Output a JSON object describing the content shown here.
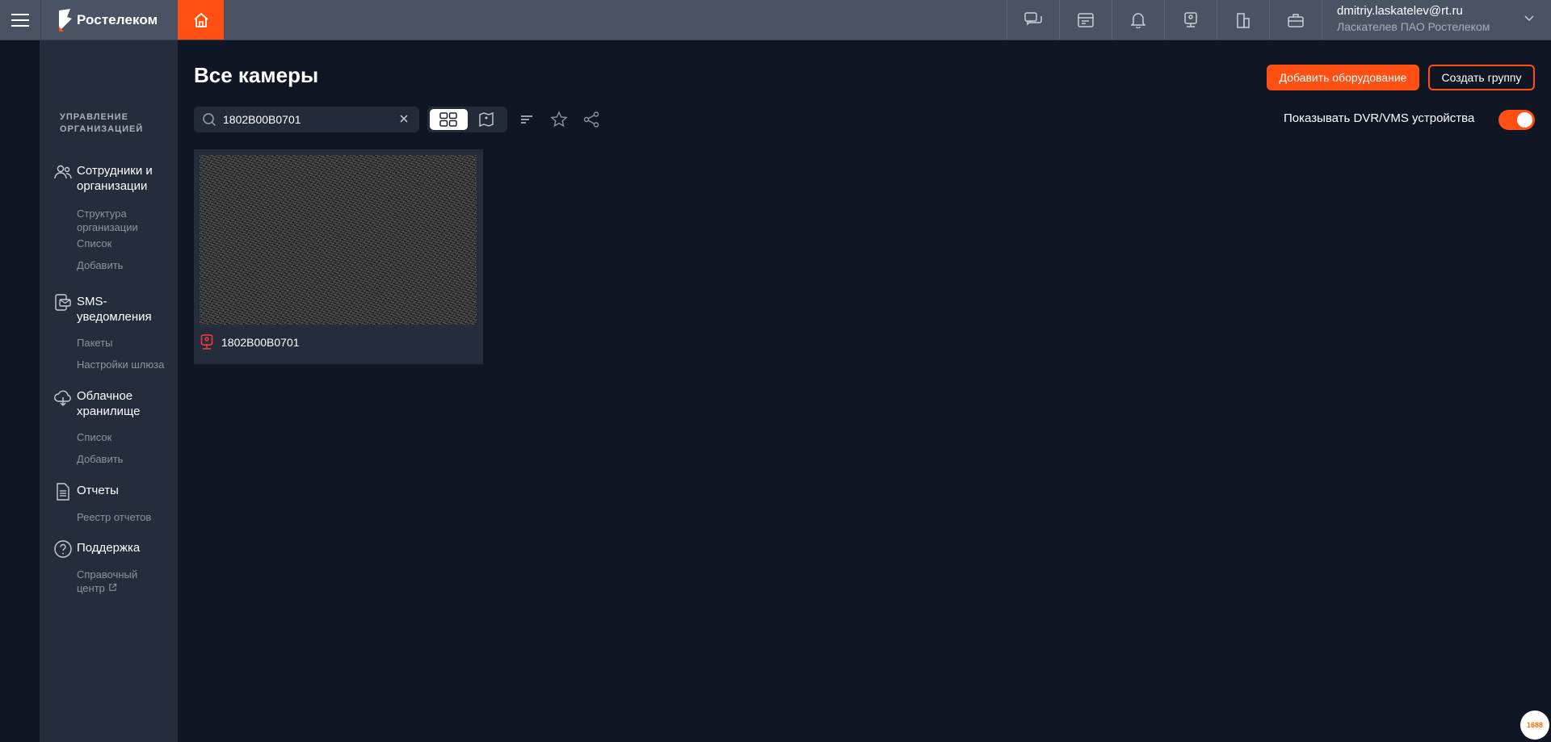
{
  "brand": {
    "name": "Ростелеком",
    "accent": "#ff4f12"
  },
  "user": {
    "email": "dmitriy.laskatelev@rt.ru",
    "org": "Ласкателев ПАО Ростелеком"
  },
  "topbar_icons": [
    "chat-icon",
    "billing-icon",
    "bell-icon",
    "camera-icon",
    "building-icon",
    "briefcase-icon"
  ],
  "sidebar": {
    "heading": "Управление организацией",
    "sections": [
      {
        "icon": "users-icon",
        "label": "Сотрудники и организации",
        "items": [
          "Структура организации",
          "Список",
          "Добавить"
        ]
      },
      {
        "icon": "sms-icon",
        "label": "SMS-уведомления",
        "items": [
          "Пакеты",
          "Настройки шлюза"
        ]
      },
      {
        "icon": "cloud-icon",
        "label": "Облачное хранилище",
        "items": [
          "Список",
          "Добавить"
        ]
      },
      {
        "icon": "document-icon",
        "label": "Отчеты",
        "items": [
          "Реестр отчетов"
        ]
      },
      {
        "icon": "help-icon",
        "label": "Поддержка",
        "items": [
          "Справочный центр"
        ]
      }
    ]
  },
  "main": {
    "title": "Все камеры",
    "add_equipment_label": "Добавить оборудование",
    "create_group_label": "Создать группу",
    "search_value": "1802B00B0701",
    "show_dvr_label": "Показывать DVR/VMS устройства",
    "show_dvr_enabled": true,
    "cameras": [
      {
        "name": "1802B00B0701"
      }
    ]
  },
  "corner_badge": "1688"
}
